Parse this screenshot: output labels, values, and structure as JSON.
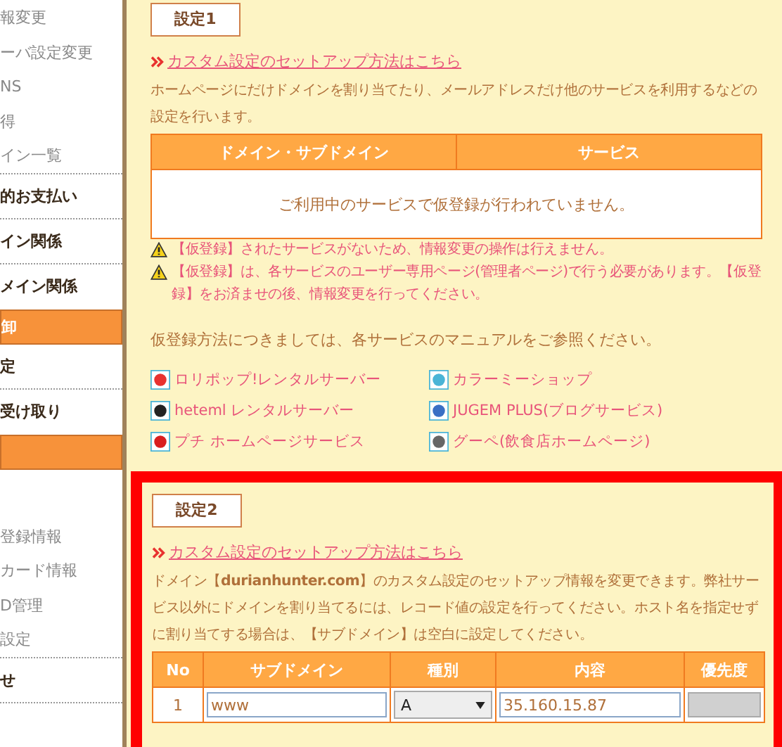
{
  "sidebar": {
    "items": [
      {
        "label": "報変更",
        "kind": "normal"
      },
      {
        "label": "ーバ設定変更",
        "kind": "normal"
      },
      {
        "label": "NS",
        "kind": "normal"
      },
      {
        "label": "得",
        "kind": "normal"
      },
      {
        "label": "イン一覧",
        "kind": "normal",
        "divider": true
      },
      {
        "label": "的お支払い",
        "kind": "bold",
        "divider": true
      },
      {
        "label": "イン関係",
        "kind": "bold",
        "divider": true
      },
      {
        "label": "メイン関係",
        "kind": "bold"
      },
      {
        "label": "卸",
        "kind": "highlight"
      },
      {
        "label": "定",
        "kind": "bold",
        "divider": true
      },
      {
        "label": "受け取り",
        "kind": "bold"
      },
      {
        "kind": "highlight"
      },
      {
        "kind": "spacer"
      },
      {
        "label": "登録情報",
        "kind": "normal"
      },
      {
        "label": "カード情報",
        "kind": "normal"
      },
      {
        "label": "D管理",
        "kind": "normal"
      },
      {
        "label": "設定",
        "kind": "normal",
        "divider": true
      },
      {
        "label": "せ",
        "kind": "bold",
        "divider": true
      }
    ]
  },
  "section1": {
    "tab_label": "設定1",
    "link": "カスタム設定のセットアップ方法はこちら",
    "description": "ホームページにだけドメインを割り当てたり、メールアドレスだけ他のサービスを利用するなどの設定を行います。",
    "table": {
      "columns": [
        "ドメイン・サブドメイン",
        "サービス"
      ],
      "empty_message": "ご利用中のサービスで仮登録が行われていません。"
    },
    "warnings": [
      "【仮登録】されたサービスがないため、情報変更の操作は行えません。",
      "【仮登録】は、各サービスのユーザー専用ページ(管理者ページ)で行う必要があります。【仮登録】をお済ませの後、情報変更を行ってください。"
    ],
    "manual_note": "仮登録方法につきましては、各サービスのマニュアルをご参照ください。",
    "services": [
      {
        "name": "ロリポップ!レンタルサーバー",
        "color": "#e8322f"
      },
      {
        "name": "カラーミーショップ",
        "color": "#4ab4d6"
      },
      {
        "name": "heteml レンタルサーバー",
        "color": "#222222"
      },
      {
        "name": "JUGEM PLUS(ブログサービス)",
        "color": "#3a6fc4"
      },
      {
        "name": "プチ ホームページサービス",
        "color": "#d91e1e"
      },
      {
        "name": "グーペ(飲食店ホームページ)",
        "color": "#666666"
      }
    ]
  },
  "section2": {
    "highlighted": true,
    "tab_label": "設定2",
    "link": "カスタム設定のセットアップ方法はこちら",
    "description": "ドメイン【**durianhunter.com**】のカスタム設定のセットアップ情報を変更できます。弊社サービス以外にドメインを割り当てるには、レコード値の設定を行ってください。ホスト名を指定せずに割り当てする場合は、【サブドメイン】は空白に設定してください。",
    "table": {
      "columns": [
        "No",
        "サブドメイン",
        "種別",
        "内容",
        "優先度"
      ],
      "rows": [
        {
          "no": "1",
          "subdomain": "www",
          "type": "A",
          "content": "35.160.15.87",
          "priority_disabled": true
        }
      ]
    }
  }
}
